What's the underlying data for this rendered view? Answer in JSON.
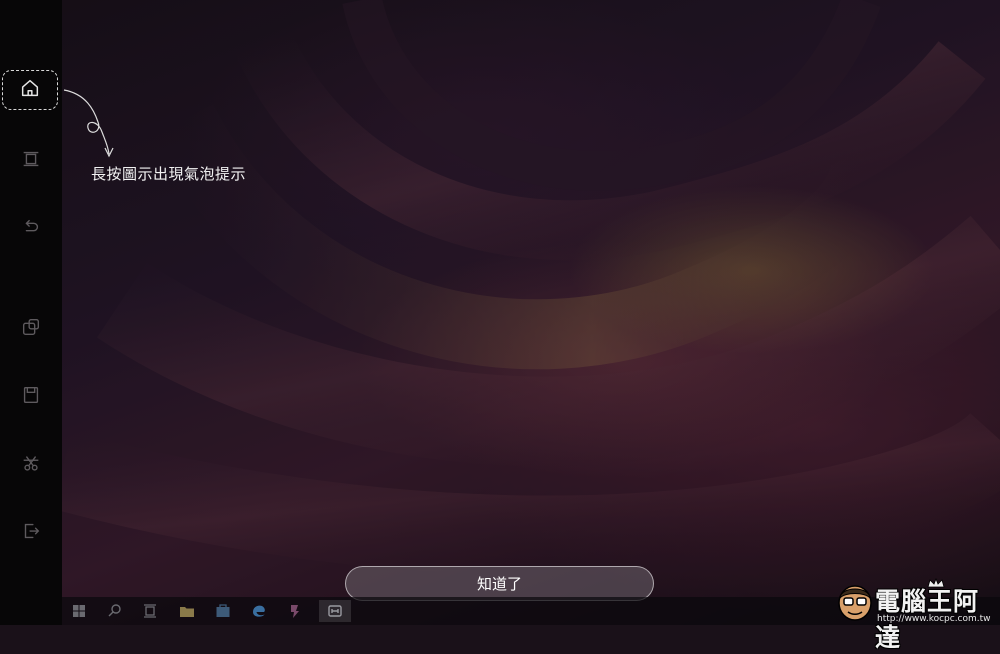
{
  "sidebar": {
    "items": [
      {
        "name": "home",
        "icon": "home-icon"
      },
      {
        "name": "task-view",
        "icon": "task-view-icon"
      },
      {
        "name": "back",
        "icon": "back-icon"
      },
      {
        "name": "floating-windows",
        "icon": "floating-window-icon"
      },
      {
        "name": "save",
        "icon": "save-icon"
      },
      {
        "name": "screenshot",
        "icon": "scissors-icon"
      },
      {
        "name": "exit",
        "icon": "exit-icon"
      }
    ]
  },
  "hint": {
    "text": "長按圖示出現氣泡提示"
  },
  "ok_button": {
    "label": "知道了"
  },
  "taskbar": {
    "icons": [
      "windows-start-icon",
      "search-icon",
      "task-view-icon",
      "file-explorer-icon",
      "store-icon",
      "edge-icon",
      "paint-app-icon",
      "app-icon"
    ]
  },
  "watermark": {
    "title": "電腦王阿達",
    "url": "http://www.kocpc.com.tw"
  }
}
